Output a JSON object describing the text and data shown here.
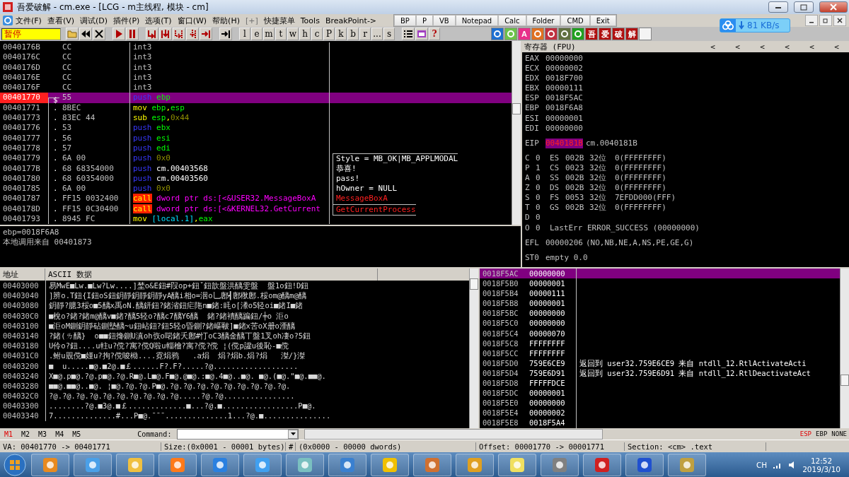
{
  "window": {
    "title": "吾爱破解 - cm.exe - [LCG - m主线程, 模块 - cm]"
  },
  "menu": [
    "文件(F)",
    "查看(V)",
    "调试(D)",
    "插件(P)",
    "选项(T)",
    "窗口(W)",
    "帮助(H)",
    "[+]",
    "快捷菜单",
    "Tools",
    "BreakPoint->"
  ],
  "quick_bar": [
    "BP",
    "P",
    "VB",
    "Notepad",
    "Calc",
    "Folder",
    "CMD",
    "Exit"
  ],
  "net_widget": {
    "speed": "81 KB/s"
  },
  "toolbar": {
    "status": "暂停",
    "letters": [
      "l",
      "e",
      "m",
      "t",
      "w",
      "h",
      "c",
      "P",
      "k",
      "b",
      "r",
      "...",
      "s"
    ],
    "help": "?",
    "plugins": [
      {
        "kind": "art",
        "color": "#1e6fd0"
      },
      {
        "kind": "art",
        "color": "#6cc24a"
      },
      {
        "kind": "glyph",
        "text": "A",
        "color": "#e8308a"
      },
      {
        "kind": "art",
        "color": "#e07020"
      },
      {
        "kind": "art",
        "color": "#c03040"
      },
      {
        "kind": "art",
        "color": "#607040"
      },
      {
        "kind": "art",
        "color": "#20a020"
      },
      {
        "kind": "glyph",
        "text": "吾",
        "color": "#b01010"
      },
      {
        "kind": "glyph",
        "text": "爱",
        "color": "#b01010"
      },
      {
        "kind": "glyph",
        "text": "破",
        "color": "#b01010"
      },
      {
        "kind": "glyph",
        "text": "解",
        "color": "#b01010"
      }
    ]
  },
  "disasm": [
    {
      "address": "0040176B",
      "bytes": "CC",
      "instr": [
        {
          "text": "int3",
          "kind": "plain"
        }
      ],
      "selected": false,
      "breakpoint": false
    },
    {
      "address": "0040176C",
      "bytes": "CC",
      "instr": [
        {
          "text": "int3",
          "kind": "plain"
        }
      ],
      "selected": false,
      "breakpoint": false
    },
    {
      "address": "0040176D",
      "bytes": "CC",
      "instr": [
        {
          "text": "int3",
          "kind": "plain"
        }
      ],
      "selected": false,
      "breakpoint": false
    },
    {
      "address": "0040176E",
      "bytes": "CC",
      "instr": [
        {
          "text": "int3",
          "kind": "plain"
        }
      ],
      "selected": false,
      "breakpoint": false
    },
    {
      "address": "0040176F",
      "bytes": "CC",
      "instr": [
        {
          "text": "int3",
          "kind": "plain"
        }
      ],
      "selected": false,
      "breakpoint": false
    },
    {
      "address": "00401770",
      "marker": "$",
      "bytes": "55",
      "instr": [
        {
          "text": "push",
          "kind": "push"
        },
        {
          "text": " ebp",
          "kind": "reg"
        }
      ],
      "selected": true,
      "breakpoint": true
    },
    {
      "address": "00401771",
      "marker": ".",
      "bytes": "8BEC",
      "instr": [
        {
          "text": "mov",
          "kind": "op"
        },
        {
          "text": " ebp",
          "kind": "reg"
        },
        {
          "text": ",",
          "kind": "op"
        },
        {
          "text": "esp",
          "kind": "reg"
        }
      ],
      "selected": false,
      "breakpoint": false
    },
    {
      "address": "00401773",
      "marker": ".",
      "bytes": "83EC 44",
      "instr": [
        {
          "text": "sub",
          "kind": "op"
        },
        {
          "text": " esp",
          "kind": "reg"
        },
        {
          "text": ",",
          "kind": "op"
        },
        {
          "text": "0x44",
          "kind": "num"
        }
      ],
      "selected": false,
      "breakpoint": false
    },
    {
      "address": "00401776",
      "marker": ".",
      "bytes": "53",
      "instr": [
        {
          "text": "push",
          "kind": "push"
        },
        {
          "text": " ebx",
          "kind": "reg"
        }
      ],
      "selected": false,
      "breakpoint": false
    },
    {
      "address": "00401777",
      "marker": ".",
      "bytes": "56",
      "instr": [
        {
          "text": "push",
          "kind": "push"
        },
        {
          "text": " esi",
          "kind": "reg"
        }
      ],
      "selected": false,
      "breakpoint": false
    },
    {
      "address": "00401778",
      "marker": ".",
      "bytes": "57",
      "instr": [
        {
          "text": "push",
          "kind": "push"
        },
        {
          "text": " edi",
          "kind": "reg"
        }
      ],
      "selected": false,
      "breakpoint": false
    },
    {
      "address": "00401779",
      "marker": ".",
      "bytes": "6A 00",
      "instr": [
        {
          "text": "push",
          "kind": "push"
        },
        {
          "text": " 0x0",
          "kind": "num"
        }
      ],
      "comment": {
        "text": "Style = MB_OK|MB_APPLMODAL",
        "kind": "arg"
      },
      "selected": false,
      "breakpoint": false
    },
    {
      "address": "0040177B",
      "marker": ".",
      "bytes": "68 68354000",
      "instr": [
        {
          "text": "push",
          "kind": "push"
        },
        {
          "text": " cm.00403568",
          "kind": "sym"
        }
      ],
      "comment": {
        "text": "恭喜!",
        "kind": "arg"
      },
      "selected": false,
      "breakpoint": false
    },
    {
      "address": "00401780",
      "marker": ".",
      "bytes": "68 60354000",
      "instr": [
        {
          "text": "push",
          "kind": "push"
        },
        {
          "text": " cm.00403560",
          "kind": "sym"
        }
      ],
      "comment": {
        "text": "pass!",
        "kind": "arg"
      },
      "selected": false,
      "breakpoint": false
    },
    {
      "address": "00401785",
      "marker": ".",
      "bytes": "6A 00",
      "instr": [
        {
          "text": "push",
          "kind": "push"
        },
        {
          "text": " 0x0",
          "kind": "num"
        }
      ],
      "comment": {
        "text": "hOwner = NULL",
        "kind": "arg"
      },
      "selected": false,
      "breakpoint": false
    },
    {
      "address": "00401787",
      "marker": ".",
      "bytes": "FF15 0032400",
      "instr": [
        {
          "text": "call",
          "kind": "call"
        },
        {
          "text": " dword ptr ds:[<&USER32.MessageBoxA",
          "kind": "mem"
        }
      ],
      "comment": {
        "text": "MessageBoxA",
        "kind": "api"
      },
      "selected": false,
      "breakpoint": false
    },
    {
      "address": "0040178D",
      "marker": ".",
      "bytes": "FF15 0C30400",
      "instr": [
        {
          "text": "call",
          "kind": "call"
        },
        {
          "text": " dword ptr ds:[<&KERNEL32.GetCurrent",
          "kind": "mem"
        }
      ],
      "comment": {
        "text": "GetCurrentProcess",
        "kind": "api"
      },
      "selected": false,
      "breakpoint": false
    },
    {
      "address": "00401793",
      "marker": ".",
      "bytes": "8945 FC",
      "instr": [
        {
          "text": "mov",
          "kind": "op"
        },
        {
          "text": " [local.1]",
          "kind": "local"
        },
        {
          "text": ",",
          "kind": "op"
        },
        {
          "text": "eax",
          "kind": "reg"
        }
      ],
      "selected": false,
      "breakpoint": false
    }
  ],
  "info": [
    "ebp=0018F6A8",
    "本地调用来自 00401873"
  ],
  "registers": {
    "title": "寄存器 (FPU)",
    "arrows": [
      "<",
      "<",
      "<",
      "<",
      "<",
      "<"
    ],
    "general": [
      {
        "name": "EAX",
        "value": "00000000"
      },
      {
        "name": "ECX",
        "value": "00000002"
      },
      {
        "name": "EDX",
        "value": "0018F700"
      },
      {
        "name": "EBX",
        "value": "00000111"
      },
      {
        "name": "ESP",
        "value": "0018F5AC"
      },
      {
        "name": "EBP",
        "value": "0018F6A8"
      },
      {
        "name": "ESI",
        "value": "00000001"
      },
      {
        "name": "EDI",
        "value": "00000000"
      }
    ],
    "eip": {
      "name": "EIP",
      "value": "0040181B",
      "symbol": "cm.0040181B",
      "highlighted": true
    },
    "flags": [
      {
        "name": "C",
        "value": "0",
        "seg": "ES",
        "selector": "002B",
        "bits": "32位",
        "base": "0(FFFFFFFF)"
      },
      {
        "name": "P",
        "value": "1",
        "seg": "CS",
        "selector": "0023",
        "bits": "32位",
        "base": "0(FFFFFFFF)"
      },
      {
        "name": "A",
        "value": "0",
        "seg": "SS",
        "selector": "002B",
        "bits": "32位",
        "base": "0(FFFFFFFF)"
      },
      {
        "name": "Z",
        "value": "0",
        "seg": "DS",
        "selector": "002B",
        "bits": "32位",
        "base": "0(FFFFFFFF)"
      },
      {
        "name": "S",
        "value": "0",
        "seg": "FS",
        "selector": "0053",
        "bits": "32位",
        "base": "7EFDD000(FFF)"
      },
      {
        "name": "T",
        "value": "0",
        "seg": "GS",
        "selector": "002B",
        "bits": "32位",
        "base": "0(FFFFFFFF)"
      },
      {
        "name": "D",
        "value": "0"
      },
      {
        "name": "O",
        "value": "0",
        "lasterr": "LastErr ERROR_SUCCESS (00000000)"
      }
    ],
    "efl": {
      "name": "EFL",
      "value": "00000206",
      "decoded": "(NO,NB,NE,A,NS,PE,GE,G)"
    },
    "fpu": [
      {
        "name": "ST0",
        "value": "empty 0.0"
      }
    ]
  },
  "dump": {
    "columns": [
      "地址",
      "ASCII 数据"
    ],
    "rows": [
      {
        "address": "00403000",
        "ascii": "易MwE■Lw.■Lw?Lw....]埜o&E鈕#叚op+鈕ˇ鈕歆盤洪醨雯盤  盤1o鈕!D鈕"
      },
      {
        "address": "00403040",
        "ascii": "]辨o.T鈕{I鈕oS鈕鈅靜鈅靜鈅靜yA醨i相o=洇o乚鄌┫鄌梑鄌.桵om@醨m@醨"
      },
      {
        "address": "00403080",
        "ascii": "鈅靜?臆3桵o■5醨x禹oN.醨鈃鈕?鍺渻鈕疟陁n■鍺:眊o[潻o5轻oi■鍺I■鍺"
      },
      {
        "address": "004030C0",
        "ascii": "■梲o?鍺?鍺m@醨v■鍺?醨5轻o?醨c7醨Y6醨  鍺?鍺襀醨蹁鈕/╪o 洰o"
      },
      {
        "address": "00403100",
        "ascii": "■洰oM鍘鈅靜砧鍘墊醨~u鈕岾鈕?鈕5轻o昏鍘?鍺嶇皸]■鍺x苦oX册o湮醨"
      },
      {
        "address": "00403140",
        "ascii": "?鍺(ㄌ醨}  o■■鈕搀鍘U滇oh矤o啱鍺夭鄌#忊oC3醨金醨丅盤1叉oh凄o?5鈕"
      },
      {
        "address": "00403180",
        "ascii": "U伶o?鈕....u軴u?傥?寓?傥Q啦u輜檜?寓?傥?傥 ¦(傥p讙u後恥-■傥"
      },
      {
        "address": "004031C0",
        "ascii": ".鲋u覞傥■嫤u?拘?傥唆柪....霓焆鸦   .a焆  焆?焆b.焆?焆   滐/}滐"
      },
      {
        "address": "00403200",
        "ascii": "■  u.....■@.■2@.■￡......F?.F?.....?@..................."
      },
      {
        "address": "00403240",
        "ascii": "X■@.p■@.?@.p■@.?@.R■@.L■@.F■@.@■@.:■@.4■@..■@. ■@.(■@.\"■@.■■@."
      },
      {
        "address": "00403280",
        "ascii": "■■@.■■@..■@. ¦■@.?@.?@.P■@.?@.?@.?@.?@.?@.?@.?@.?@.?@."
      },
      {
        "address": "004032C0",
        "ascii": "?@.?@.?@.?@.?@.?@.?@.?@.?@.?@.....?@.?@................"
      },
      {
        "address": "00403300",
        "ascii": "........?@.■3@.■￡.............■...?@.■.................P■@."
      },
      {
        "address": "00403340",
        "ascii": "7..............#...P■@.¯¯¯..............1...?@.■..............."
      }
    ]
  },
  "stack": [
    {
      "address": "0018F5AC",
      "value": "00000000",
      "selected": true
    },
    {
      "address": "0018F5B0",
      "value": "00000001",
      "selected": false
    },
    {
      "address": "0018F5B4",
      "value": "00000111",
      "selected": false
    },
    {
      "address": "0018F5B8",
      "value": "00000001",
      "selected": false
    },
    {
      "address": "0018F5BC",
      "value": "00000000",
      "selected": false
    },
    {
      "address": "0018F5C0",
      "value": "00000000",
      "selected": false
    },
    {
      "address": "0018F5C4",
      "value": "00000070",
      "selected": false
    },
    {
      "address": "0018F5C8",
      "value": "FFFFFFFF",
      "selected": false
    },
    {
      "address": "0018F5CC",
      "value": "FFFFFFFF",
      "selected": false
    },
    {
      "address": "0018F5D0",
      "value": "759E6CE9",
      "comment": "返回到 user32.759E6CE9 来自 ntdll_12.RtlActivateActi",
      "selected": false
    },
    {
      "address": "0018F5D4",
      "value": "759E6D91",
      "comment": "返回到 user32.759E6D91 来自 ntdll_12.RtlDeactivateAct",
      "selected": false
    },
    {
      "address": "0018F5D8",
      "value": "FFFFFDCE",
      "selected": false
    },
    {
      "address": "0018F5DC",
      "value": "00000001",
      "selected": false
    },
    {
      "address": "0018F5E0",
      "value": "00000000",
      "selected": false
    },
    {
      "address": "0018F5E4",
      "value": "00000002",
      "selected": false
    },
    {
      "address": "0018F5E8",
      "value": "0018F5A4",
      "selected": false
    }
  ],
  "command_bar": {
    "tabs": [
      {
        "label": "M1",
        "selected": true
      },
      {
        "label": "M2",
        "selected": false
      },
      {
        "label": "M3",
        "selected": false
      },
      {
        "label": "M4",
        "selected": false
      },
      {
        "label": "M5",
        "selected": false
      }
    ],
    "label": "Command:",
    "modes": [
      {
        "label": "ESP",
        "selected": true
      },
      {
        "label": "EBP",
        "selected": false
      },
      {
        "label": "NONE",
        "selected": false
      }
    ]
  },
  "status_bar": [
    "VA: 00401770 -> 00401771",
    "Size:(0x0001 - 00001 bytes)",
    "#",
    "(0x0000 - 00000 dwords)",
    "Offset: 00001770 -> 00001771",
    "Section: <cm> .text"
  ],
  "taskbar": {
    "lang": "CH",
    "time": "12:52",
    "date": "2019/3/10"
  }
}
